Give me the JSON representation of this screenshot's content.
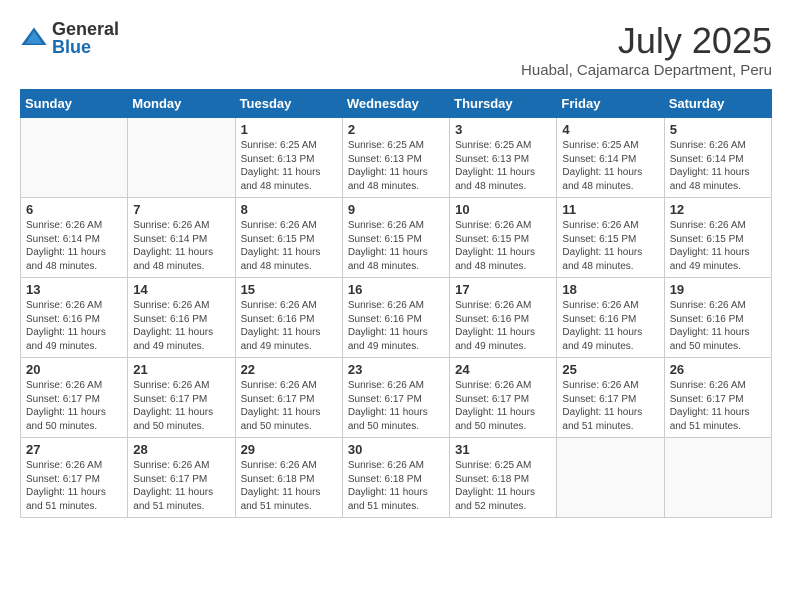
{
  "header": {
    "logo_general": "General",
    "logo_blue": "Blue",
    "month_year": "July 2025",
    "location": "Huabal, Cajamarca Department, Peru"
  },
  "days_of_week": [
    "Sunday",
    "Monday",
    "Tuesday",
    "Wednesday",
    "Thursday",
    "Friday",
    "Saturday"
  ],
  "weeks": [
    [
      {
        "day": "",
        "info": ""
      },
      {
        "day": "",
        "info": ""
      },
      {
        "day": "1",
        "info": "Sunrise: 6:25 AM\nSunset: 6:13 PM\nDaylight: 11 hours and 48 minutes."
      },
      {
        "day": "2",
        "info": "Sunrise: 6:25 AM\nSunset: 6:13 PM\nDaylight: 11 hours and 48 minutes."
      },
      {
        "day": "3",
        "info": "Sunrise: 6:25 AM\nSunset: 6:13 PM\nDaylight: 11 hours and 48 minutes."
      },
      {
        "day": "4",
        "info": "Sunrise: 6:25 AM\nSunset: 6:14 PM\nDaylight: 11 hours and 48 minutes."
      },
      {
        "day": "5",
        "info": "Sunrise: 6:26 AM\nSunset: 6:14 PM\nDaylight: 11 hours and 48 minutes."
      }
    ],
    [
      {
        "day": "6",
        "info": "Sunrise: 6:26 AM\nSunset: 6:14 PM\nDaylight: 11 hours and 48 minutes."
      },
      {
        "day": "7",
        "info": "Sunrise: 6:26 AM\nSunset: 6:14 PM\nDaylight: 11 hours and 48 minutes."
      },
      {
        "day": "8",
        "info": "Sunrise: 6:26 AM\nSunset: 6:15 PM\nDaylight: 11 hours and 48 minutes."
      },
      {
        "day": "9",
        "info": "Sunrise: 6:26 AM\nSunset: 6:15 PM\nDaylight: 11 hours and 48 minutes."
      },
      {
        "day": "10",
        "info": "Sunrise: 6:26 AM\nSunset: 6:15 PM\nDaylight: 11 hours and 48 minutes."
      },
      {
        "day": "11",
        "info": "Sunrise: 6:26 AM\nSunset: 6:15 PM\nDaylight: 11 hours and 48 minutes."
      },
      {
        "day": "12",
        "info": "Sunrise: 6:26 AM\nSunset: 6:15 PM\nDaylight: 11 hours and 49 minutes."
      }
    ],
    [
      {
        "day": "13",
        "info": "Sunrise: 6:26 AM\nSunset: 6:16 PM\nDaylight: 11 hours and 49 minutes."
      },
      {
        "day": "14",
        "info": "Sunrise: 6:26 AM\nSunset: 6:16 PM\nDaylight: 11 hours and 49 minutes."
      },
      {
        "day": "15",
        "info": "Sunrise: 6:26 AM\nSunset: 6:16 PM\nDaylight: 11 hours and 49 minutes."
      },
      {
        "day": "16",
        "info": "Sunrise: 6:26 AM\nSunset: 6:16 PM\nDaylight: 11 hours and 49 minutes."
      },
      {
        "day": "17",
        "info": "Sunrise: 6:26 AM\nSunset: 6:16 PM\nDaylight: 11 hours and 49 minutes."
      },
      {
        "day": "18",
        "info": "Sunrise: 6:26 AM\nSunset: 6:16 PM\nDaylight: 11 hours and 49 minutes."
      },
      {
        "day": "19",
        "info": "Sunrise: 6:26 AM\nSunset: 6:16 PM\nDaylight: 11 hours and 50 minutes."
      }
    ],
    [
      {
        "day": "20",
        "info": "Sunrise: 6:26 AM\nSunset: 6:17 PM\nDaylight: 11 hours and 50 minutes."
      },
      {
        "day": "21",
        "info": "Sunrise: 6:26 AM\nSunset: 6:17 PM\nDaylight: 11 hours and 50 minutes."
      },
      {
        "day": "22",
        "info": "Sunrise: 6:26 AM\nSunset: 6:17 PM\nDaylight: 11 hours and 50 minutes."
      },
      {
        "day": "23",
        "info": "Sunrise: 6:26 AM\nSunset: 6:17 PM\nDaylight: 11 hours and 50 minutes."
      },
      {
        "day": "24",
        "info": "Sunrise: 6:26 AM\nSunset: 6:17 PM\nDaylight: 11 hours and 50 minutes."
      },
      {
        "day": "25",
        "info": "Sunrise: 6:26 AM\nSunset: 6:17 PM\nDaylight: 11 hours and 51 minutes."
      },
      {
        "day": "26",
        "info": "Sunrise: 6:26 AM\nSunset: 6:17 PM\nDaylight: 11 hours and 51 minutes."
      }
    ],
    [
      {
        "day": "27",
        "info": "Sunrise: 6:26 AM\nSunset: 6:17 PM\nDaylight: 11 hours and 51 minutes."
      },
      {
        "day": "28",
        "info": "Sunrise: 6:26 AM\nSunset: 6:17 PM\nDaylight: 11 hours and 51 minutes."
      },
      {
        "day": "29",
        "info": "Sunrise: 6:26 AM\nSunset: 6:18 PM\nDaylight: 11 hours and 51 minutes."
      },
      {
        "day": "30",
        "info": "Sunrise: 6:26 AM\nSunset: 6:18 PM\nDaylight: 11 hours and 51 minutes."
      },
      {
        "day": "31",
        "info": "Sunrise: 6:25 AM\nSunset: 6:18 PM\nDaylight: 11 hours and 52 minutes."
      },
      {
        "day": "",
        "info": ""
      },
      {
        "day": "",
        "info": ""
      }
    ]
  ]
}
